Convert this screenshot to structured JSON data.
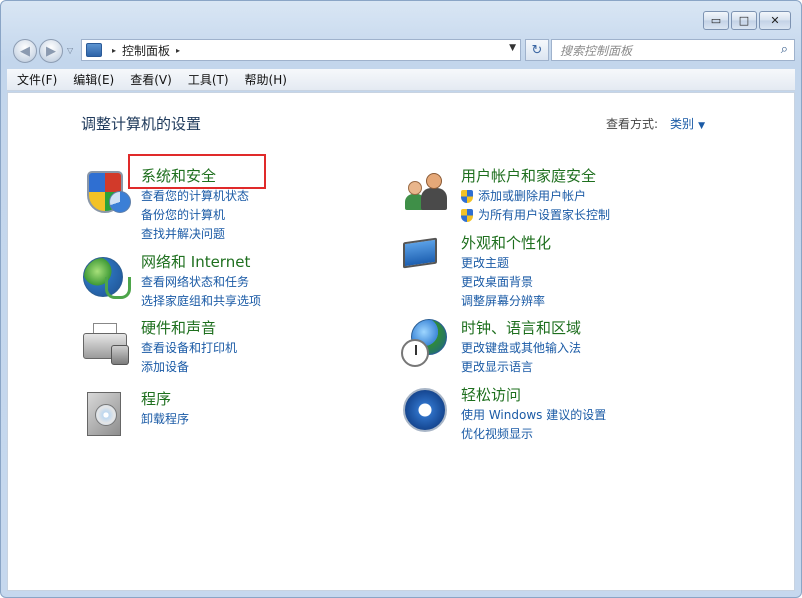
{
  "window": {
    "caption_buttons": {
      "minimize": "▭",
      "maximize": "□",
      "close": "✕"
    }
  },
  "nav": {
    "back_icon": "back-arrow-icon",
    "forward_icon": "forward-arrow-icon",
    "address_separator": "▸",
    "breadcrumb": [
      "控制面板"
    ],
    "address_dropdown": "▼",
    "refresh_icon": "refresh-icon",
    "search_placeholder": "搜索控制面板"
  },
  "menu": {
    "items": [
      "文件(F)",
      "编辑(E)",
      "查看(V)",
      "工具(T)",
      "帮助(H)"
    ]
  },
  "content": {
    "title": "调整计算机的设置",
    "view_by_label": "查看方式:",
    "view_by_value": "类别",
    "categories": [
      {
        "icon": "security-shield-icon",
        "title": "系统和安全",
        "links": [
          "查看您的计算机状态",
          "备份您的计算机",
          "查找并解决问题"
        ]
      },
      {
        "icon": "network-globe-icon",
        "title": "网络和 Internet",
        "links": [
          "查看网络状态和任务",
          "选择家庭组和共享选项"
        ]
      },
      {
        "icon": "printer-speaker-icon",
        "title": "硬件和声音",
        "links": [
          "查看设备和打印机",
          "添加设备"
        ]
      },
      {
        "icon": "programs-box-icon",
        "title": "程序",
        "links": [
          "卸载程序"
        ]
      },
      {
        "icon": "users-icon",
        "title": "用户帐户和家庭安全",
        "links": [
          "添加或删除用户帐户",
          "为所有用户设置家长控制"
        ]
      },
      {
        "icon": "appearance-monitor-icon",
        "title": "外观和个性化",
        "links": [
          "更改主题",
          "更改桌面背景",
          "调整屏幕分辨率"
        ]
      },
      {
        "icon": "clock-globe-icon",
        "title": "时钟、语言和区域",
        "links": [
          "更改键盘或其他输入法",
          "更改显示语言"
        ]
      },
      {
        "icon": "ease-of-access-icon",
        "title": "轻松访问",
        "links": [
          "使用 Windows 建议的设置",
          "优化视频显示"
        ]
      }
    ]
  },
  "colors": {
    "category_title": "#1e6f1e",
    "link": "#1b5ba6",
    "highlight": "#e02a2a"
  }
}
